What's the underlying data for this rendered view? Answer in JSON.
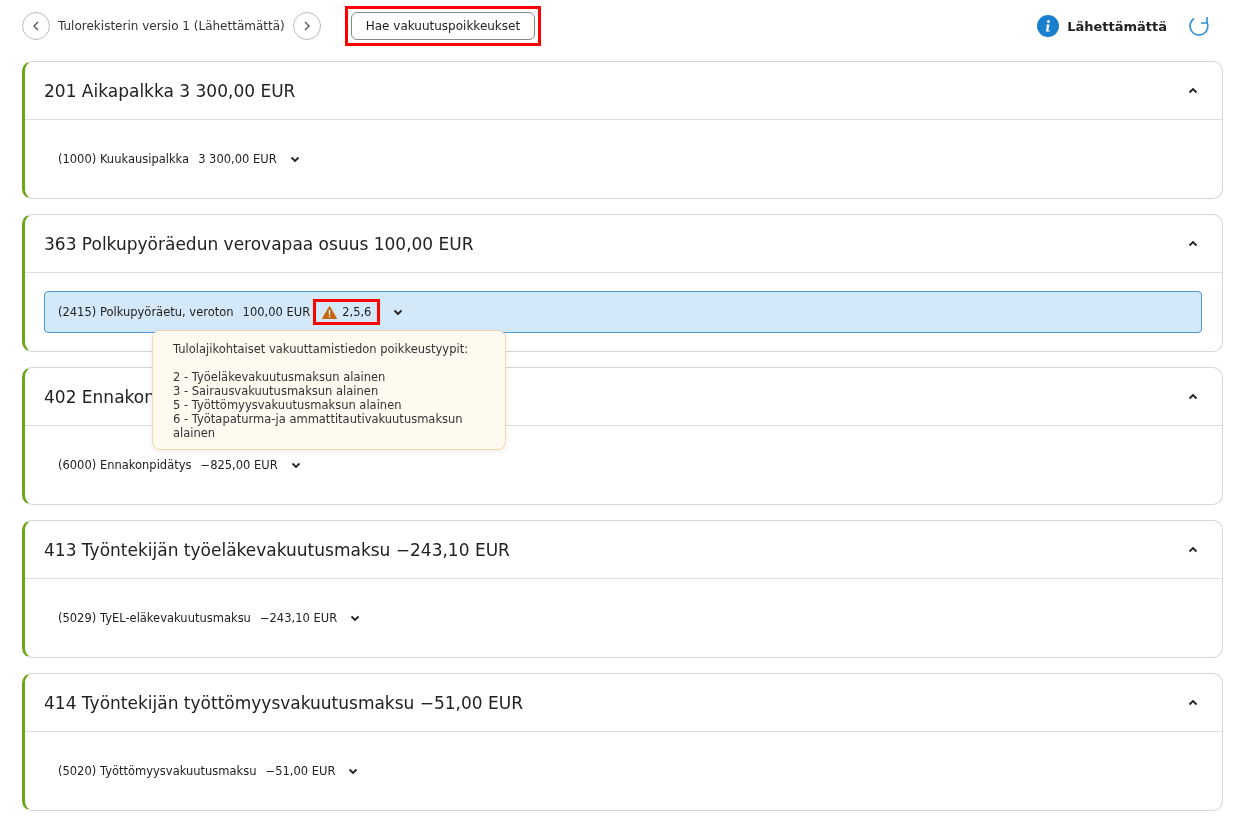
{
  "toolbar": {
    "version_label": "Tulorekisterin versio 1 (Lähettämättä)",
    "fetch_button": {
      "label": "Hae vakuutuspoikkeukset",
      "highlighted": true
    },
    "status": "Lähettämättä"
  },
  "sections": [
    {
      "title": "201 Aikapalkka 3 300,00 EUR",
      "expanded": true,
      "rows": [
        {
          "name": "(1000) Kuukausipalkka",
          "amount": "3 300,00 EUR",
          "selected": false
        }
      ]
    },
    {
      "title": "363 Polkupyöräedun verovapaa osuus 100,00 EUR",
      "expanded": true,
      "rows": [
        {
          "name": "(2415) Polkupyöräetu, veroton",
          "amount": "100,00 EUR",
          "selected": true,
          "warning": {
            "codes": "2,5,6",
            "highlighted": true
          }
        }
      ]
    },
    {
      "title": "402 Ennakon",
      "expanded": true,
      "rows": [
        {
          "name": "(6000) Ennakonpidätys",
          "amount": "−825,00 EUR",
          "selected": false
        }
      ]
    },
    {
      "title": "413 Työntekijän työeläkevakuutusmaksu −243,10 EUR",
      "expanded": true,
      "rows": [
        {
          "name": "(5029) TyEL-eläkevakuutusmaksu",
          "amount": "−243,10 EUR",
          "selected": false
        }
      ]
    },
    {
      "title": "414 Työntekijän työttömyysvakuutusmaksu −51,00 EUR",
      "expanded": true,
      "rows": [
        {
          "name": "(5020) Työttömyysvakuutusmaksu",
          "amount": "−51,00 EUR",
          "selected": false
        }
      ]
    }
  ],
  "tooltip": {
    "heading": "Tulolajikohtaiset vakuuttamistiedon poikkeustyypit:",
    "lines": [
      "2 - Työeläkevakuutusmaksun alainen",
      "3 - Sairausvakuutusmaksun alainen",
      "5 - Työttömyysvakuutusmaksun alainen",
      "6 - Työtapaturma-ja ammattitautivakuutusmaksun alainen"
    ]
  }
}
